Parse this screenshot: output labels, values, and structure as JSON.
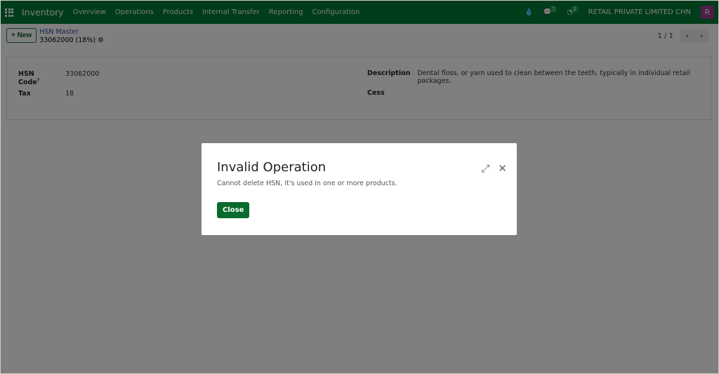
{
  "navbar": {
    "app": "Inventory",
    "menu": [
      "Overview",
      "Operations",
      "Products",
      "Internal Transfer",
      "Reporting",
      "Configuration"
    ],
    "messages_count": "7",
    "activities_count": "2",
    "company": "RETAIL PRIVATE LIMITED CHN",
    "avatar": "R"
  },
  "control_panel": {
    "new_label": "New",
    "breadcrumb_parent": "HSN Master",
    "record_name": "33062000 (18%)",
    "pager": "1 / 1"
  },
  "form": {
    "hsn_code_label": "HSN Code",
    "hsn_code_help": "?",
    "hsn_code": "33062000",
    "tax_label": "Tax",
    "tax": "18",
    "description_label": "Description",
    "description": "Dental floss, or yarn used to clean between the teeth, typically in individual retail packages.",
    "cess_label": "Cess",
    "cess": ""
  },
  "dialog": {
    "title": "Invalid Operation",
    "message": "Cannot delete HSN, It's used in one or more products.",
    "close_label": "Close"
  }
}
